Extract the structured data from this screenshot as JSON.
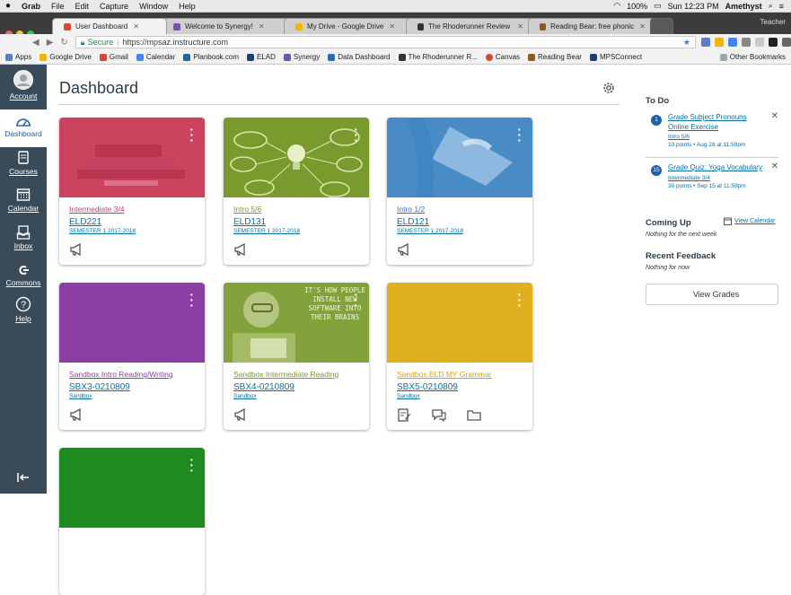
{
  "menubar": {
    "items": [
      "Grab",
      "File",
      "Edit",
      "Capture",
      "Window",
      "Help"
    ],
    "battery": "100%",
    "clock": "Sun 12:23 PM",
    "user": "Amethyst"
  },
  "browser": {
    "tabs": [
      {
        "title": "User Dashboard",
        "color": "#d64a2c",
        "active": true
      },
      {
        "title": "Welcome to Synergy!",
        "color": "#7b4fb5",
        "active": false
      },
      {
        "title": "My Drive - Google Drive",
        "color": "#f5b400",
        "active": false
      },
      {
        "title": "The Rhoderunner Review – W",
        "color": "#333333",
        "active": false
      },
      {
        "title": "Reading Bear: free phonics &",
        "color": "#8a5a2b",
        "active": false
      }
    ],
    "profile": "Teacher",
    "secure_label": "Secure",
    "url": "https://mpsaz.instructure.com",
    "bookmarks": [
      {
        "label": "Apps",
        "color": "#5b7ec9"
      },
      {
        "label": "Google Drive",
        "color": "#f5b400"
      },
      {
        "label": "Gmail",
        "color": "#d44638"
      },
      {
        "label": "Calendar",
        "color": "#4285f4"
      },
      {
        "label": "Planbook.com",
        "color": "#2b5fa6"
      },
      {
        "label": "ELAD",
        "color": "#1f3f7a"
      },
      {
        "label": "Synergy",
        "color": "#7b4fb5"
      },
      {
        "label": "Data Dashboard",
        "color": "#2b6cb0"
      },
      {
        "label": "The Rhoderunner R...",
        "color": "#333333"
      },
      {
        "label": "Canvas",
        "color": "#d64a2c"
      },
      {
        "label": "Reading Bear",
        "color": "#8a5a2b"
      },
      {
        "label": "MPSConnect",
        "color": "#1f3f7a"
      }
    ],
    "other_bookmarks": "Other Bookmarks"
  },
  "nav": {
    "account": "Account",
    "dashboard": "Dashboard",
    "courses": "Courses",
    "calendar": "Calendar",
    "inbox": "Inbox",
    "commons": "Commons",
    "help": "Help"
  },
  "page": {
    "title": "Dashboard"
  },
  "cards": [
    {
      "title": "Intermediate 3/4",
      "code": "ELD221",
      "term": "SEMESTER 1 2017-2018",
      "color": "#c83f5a",
      "icon": "gavel-steps-image"
    },
    {
      "title": "Intro 5/6",
      "code": "ELD131",
      "term": "SEMESTER 1 2017-2018",
      "color": "#7a9a2e",
      "icon": "lightbulb-mindmap-image"
    },
    {
      "title": "Intro 1/2",
      "code": "ELD121",
      "term": "SEMESTER 1 2017-2018",
      "color": "#2e78b8",
      "icon": "laptop-hands-image"
    },
    {
      "title": "Sandbox Intro Reading/Writing",
      "code": "SBX3-0210809",
      "term": "Sandbox",
      "color": "#8c3fa3",
      "icon": ""
    },
    {
      "title": "Sandbox Intermediate Reading",
      "code": "SBX4-0210809",
      "term": "Sandbox",
      "color": "#7a9a2e",
      "icon": "child-reading-image",
      "hero_text": "IT'S HOW PEOPLE INSTALL NEW SOFTWARE INTO THEIR BRAINS"
    },
    {
      "title": "Sandbox ELD MY Grammar",
      "code": "SBX5-0210809",
      "term": "Sandbox",
      "color": "#e0b020",
      "icon": ""
    },
    {
      "title": "",
      "code": "",
      "term": "",
      "color": "#1f8a1f",
      "icon": ""
    }
  ],
  "sidebar": {
    "todo_heading": "To Do",
    "todo": [
      {
        "badge": "1",
        "title": "Grade Subject Pronouns Online Exercise",
        "course": "Intro 5/6",
        "meta": "10 points • Aug 28 at 11:59pm"
      },
      {
        "badge": "15",
        "title": "Grade Quiz: Yoga Vocabulary",
        "course": "Intermediate 3/4",
        "meta": "30 points • Sep 15 at 11:59pm"
      }
    ],
    "coming_up": "Coming Up",
    "view_calendar": "View Calendar",
    "coming_up_empty": "Nothing for the next week",
    "recent_feedback": "Recent Feedback",
    "feedback_empty": "Nothing for now",
    "view_grades": "View Grades"
  }
}
